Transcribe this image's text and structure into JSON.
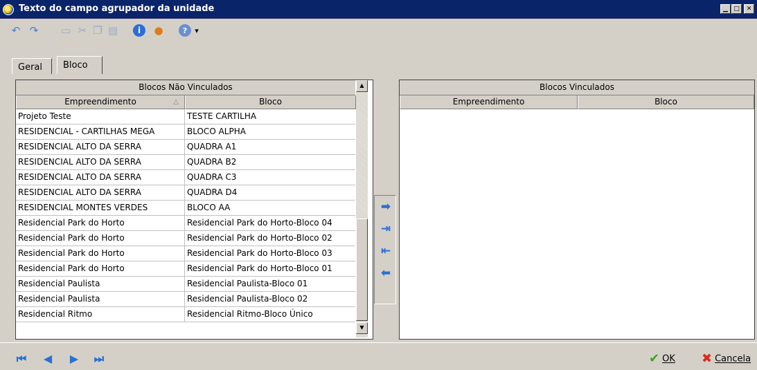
{
  "window": {
    "title": "Texto do campo agrupador da unidade",
    "minimize_glyph": "▁",
    "maximize_glyph": "□",
    "close_glyph": "✕"
  },
  "toolbar": {
    "icons": [
      "undo-icon",
      "redo-icon",
      "new-document-icon",
      "cut-icon",
      "copy-icon",
      "paste-icon",
      "info-icon",
      "user-icon",
      "help-icon"
    ],
    "dropdown_glyph": "▾"
  },
  "tabs": [
    {
      "label": "Geral",
      "active": false
    },
    {
      "label": "Bloco",
      "active": true
    }
  ],
  "left_grid": {
    "title": "Blocos Não Vinculados",
    "columns": [
      "Empreendimento",
      "Bloco"
    ],
    "sort_glyph": "△",
    "rows": [
      [
        "Projeto Teste",
        "TESTE CARTILHA"
      ],
      [
        "RESIDENCIAL - CARTILHAS MEGA",
        "BLOCO ALPHA"
      ],
      [
        "RESIDENCIAL ALTO DA SERRA",
        "QUADRA A1"
      ],
      [
        "RESIDENCIAL ALTO DA SERRA",
        "QUADRA B2"
      ],
      [
        "RESIDENCIAL ALTO DA SERRA",
        "QUADRA C3"
      ],
      [
        "RESIDENCIAL ALTO DA SERRA",
        "QUADRA D4"
      ],
      [
        "RESIDENCIAL MONTES VERDES",
        "BLOCO AA"
      ],
      [
        "Residencial Park do Horto",
        "Residencial Park do Horto-Bloco 04"
      ],
      [
        "Residencial Park do Horto",
        "Residencial Park do Horto-Bloco 02"
      ],
      [
        "Residencial Park do Horto",
        "Residencial Park do Horto-Bloco 03"
      ],
      [
        "Residencial Park do Horto",
        "Residencial Park do Horto-Bloco 01"
      ],
      [
        "Residencial Paulista",
        "Residencial Paulista-Bloco 01"
      ],
      [
        "Residencial Paulista",
        "Residencial Paulista-Bloco 02"
      ],
      [
        "Residencial Ritmo",
        "Residencial Ritmo-Bloco Único"
      ]
    ]
  },
  "right_grid": {
    "title": "Blocos Vinculados",
    "columns": [
      "Empreendimento",
      "Bloco"
    ]
  },
  "transfer_buttons": [
    "arrow-right-icon",
    "arrow-right-all-icon",
    "arrow-left-all-icon",
    "arrow-left-icon"
  ],
  "navigation": [
    "first-record-icon",
    "previous-record-icon",
    "next-record-icon",
    "last-record-icon"
  ],
  "actions": {
    "ok_label": "OK",
    "cancel_label": "Cancela"
  },
  "colors": {
    "titlebar": "#0a246a",
    "window_bg": "#d4d0c8",
    "accent_blue": "#2a6fd6",
    "ok_green": "#3aa52b",
    "cancel_red": "#d92a1c"
  }
}
